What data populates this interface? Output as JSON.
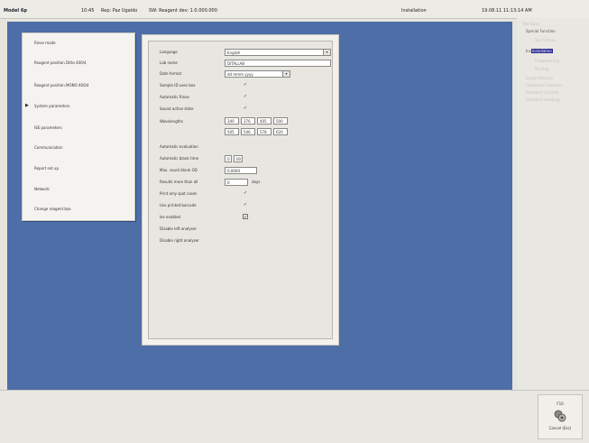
{
  "titlebar": {
    "app": "Model 6p",
    "items": [
      "10:45",
      "Rep: Paz Ugaldo",
      "SW: Reagent dev: 1.0.000.000"
    ],
    "status": "Installation",
    "datetime": "19.08.11 11:13:14 AM"
  },
  "menu": {
    "items": [
      {
        "label": "Rinse mode"
      },
      {
        "label": "Reagent position Ditto 400/4"
      },
      {
        "label": "Reagent position MONO 400/4"
      },
      {
        "label": "System parameters",
        "active": true
      },
      {
        "label": "ISE parameters"
      },
      {
        "label": "Communication"
      },
      {
        "label": "Report set up"
      },
      {
        "label": "Network"
      },
      {
        "label": "Change reagent box"
      }
    ]
  },
  "settings": {
    "language_label": "Language",
    "language_value": "English",
    "lab_name_label": "Lab name",
    "lab_name_value": "DITALLAB",
    "date_format_label": "Date format",
    "date_format_value": "dd mmm yyyy",
    "sample_id_label": "Sample ID uses box",
    "automatic_rinse_label": "Automatic Rinse",
    "sound_label": "Sound active state",
    "wavelengths_label": "Wavelengths",
    "wavelengths": [
      "340",
      "376",
      "405",
      "500",
      "505",
      "546",
      "578",
      "620"
    ],
    "auto_eval_label": "Automatic evaluation",
    "auto_blank_label": "Automatic blank time",
    "auto_blank_value": "0",
    "auto_blank_unit": "00",
    "max_count_label": "Max. count blank OD",
    "max_count_value": "0,0000",
    "results_in_label": "Results more than all",
    "results_in_value": "0",
    "results_in_unit": "days",
    "print_only_label": "Print only spot cases",
    "use_printer_label": "Use printed barcode",
    "ise_label": "Ise enabled",
    "disable_left_label": "Disable left analyser",
    "disable_right_label": "Disable right analyser",
    "check_symbol": "✓",
    "dropdown_arrow": "▾"
  },
  "tree": {
    "items": [
      {
        "label": "Test Base",
        "indent": 0
      },
      {
        "label": "Special Function",
        "indent": 1,
        "dark": true
      },
      {
        "label": "Test Entries",
        "indent": 2
      },
      {
        "label": "Installation",
        "indent": 1,
        "selected": true,
        "prefix": "Ins"
      },
      {
        "label": "Programming",
        "indent": 2
      },
      {
        "label": "Printing",
        "indent": 2
      },
      {
        "label": "Single Delivery",
        "indent": 1
      },
      {
        "label": "Calibration Samples",
        "indent": 1
      },
      {
        "label": "Standard Controls",
        "indent": 1
      },
      {
        "label": "Standard Headings",
        "indent": 1
      }
    ]
  },
  "cancel": {
    "key": "F10",
    "label": "Cancel (Esc)",
    "icon": "cancel-icon"
  },
  "colors": {
    "desktop": "#4e6ea8",
    "selection": "#2a2a90"
  }
}
